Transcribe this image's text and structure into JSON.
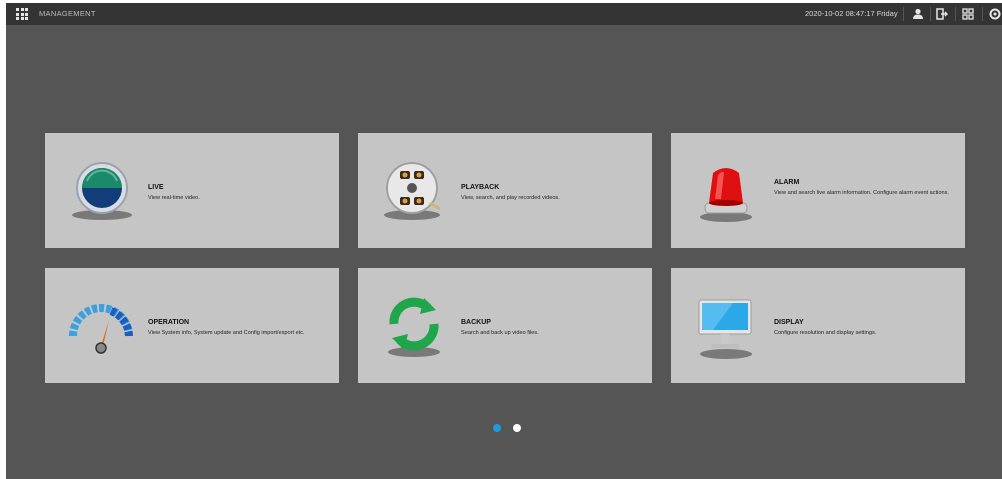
{
  "header": {
    "app_title": "MANAGEMENT",
    "datetime": "2020-10-02 08:47:17 Friday",
    "icons": [
      "grid-menu-icon",
      "user-icon",
      "logout-icon",
      "layout-icon",
      "settings-icon"
    ]
  },
  "cards": [
    {
      "key": "live",
      "title": "LIVE",
      "desc": "View real-time video.",
      "icon": "live-camera-icon"
    },
    {
      "key": "playback",
      "title": "PLAYBACK",
      "desc": "View, search, and play recorded videos.",
      "icon": "film-reel-icon"
    },
    {
      "key": "alarm",
      "title": "ALARM",
      "desc": "View and search live alarm information. Configure alarm event actions.",
      "icon": "alarm-siren-icon"
    },
    {
      "key": "operation",
      "title": "OPERATION",
      "desc": "View System info, System update and Config import/export etc.",
      "icon": "gauge-icon"
    },
    {
      "key": "backup",
      "title": "BACKUP",
      "desc": "Search and back up video files.",
      "icon": "backup-sync-icon"
    },
    {
      "key": "display",
      "title": "DISPLAY",
      "desc": "Configure resolution and display settings.",
      "icon": "monitor-icon"
    }
  ],
  "pagination": {
    "pages": 2,
    "current": 1
  },
  "colors": {
    "active_dot": "#1e9be0",
    "inactive_dot": "#ffffff",
    "card_bg": "#c5c5c5",
    "background": "#555555",
    "topbar": "#343434"
  }
}
